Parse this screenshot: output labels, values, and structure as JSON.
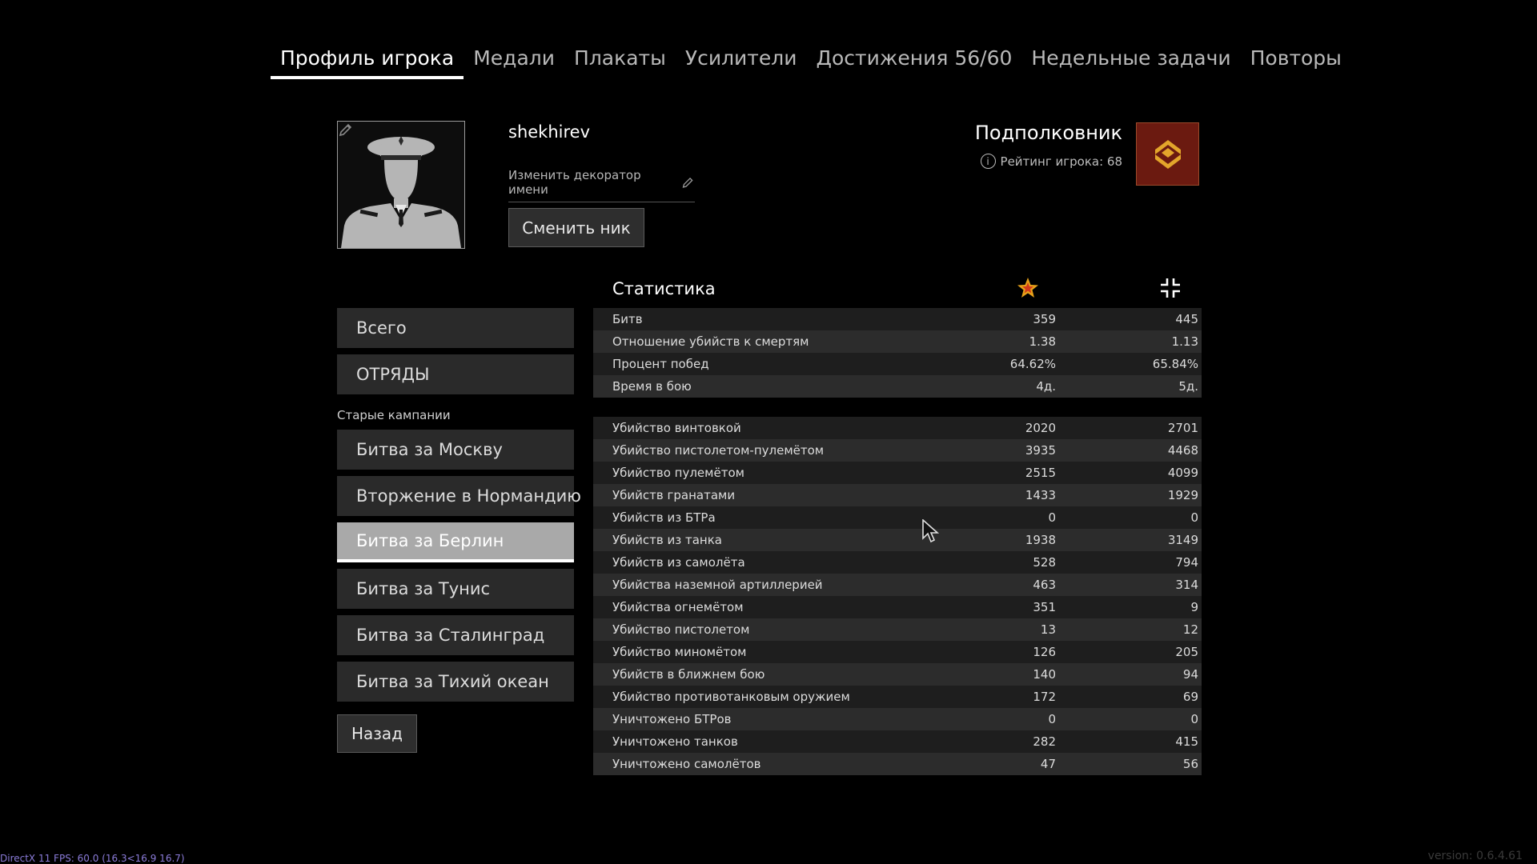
{
  "tabs": [
    {
      "label": "Профиль игрока",
      "active": true
    },
    {
      "label": "Медали"
    },
    {
      "label": "Плакаты"
    },
    {
      "label": "Усилители"
    },
    {
      "label": "Достижения 56/60"
    },
    {
      "label": "Недельные задачи"
    },
    {
      "label": "Повторы"
    }
  ],
  "profile": {
    "username": "shekhirev",
    "decorator_label": "Изменить декоратор имени",
    "change_nick_label": "Сменить ник",
    "rank_title": "Подполковник",
    "rating_label": "Рейтинг игрока: 68"
  },
  "menu": {
    "items_top": [
      "Всего",
      "ОТРЯДЫ"
    ],
    "section_label": "Старые кампании",
    "campaigns": [
      "Битва за Москву",
      "Вторжение в Нормандию",
      "Битва за Берлин",
      "Битва за Тунис",
      "Битва за Сталинград",
      "Битва за Тихий океан"
    ],
    "active_campaign": "Битва за Берлин",
    "back_label": "Назад"
  },
  "stats": {
    "title": "Статистика",
    "colors": {
      "star": "#e8a21a",
      "star_center": "#d43a1a"
    },
    "group1": [
      {
        "label": "Битв",
        "v1": "359",
        "v2": "445"
      },
      {
        "label": "Отношение убийств к смертям",
        "v1": "1.38",
        "v2": "1.13"
      },
      {
        "label": "Процент побед",
        "v1": "64.62%",
        "v2": "65.84%"
      },
      {
        "label": "Время в бою",
        "v1": "4д.",
        "v2": "5д."
      }
    ],
    "group2": [
      {
        "label": "Убийство винтовкой",
        "v1": "2020",
        "v2": "2701"
      },
      {
        "label": "Убийство пистолетом-пулемётом",
        "v1": "3935",
        "v2": "4468"
      },
      {
        "label": "Убийство пулемётом",
        "v1": "2515",
        "v2": "4099"
      },
      {
        "label": "Убийств гранатами",
        "v1": "1433",
        "v2": "1929"
      },
      {
        "label": "Убийств из БТРа",
        "v1": "0",
        "v2": "0"
      },
      {
        "label": "Убийств из танка",
        "v1": "1938",
        "v2": "3149"
      },
      {
        "label": "Убийств из самолёта",
        "v1": "528",
        "v2": "794"
      },
      {
        "label": "Убийства наземной артиллерией",
        "v1": "463",
        "v2": "314"
      },
      {
        "label": "Убийства огнемётом",
        "v1": "351",
        "v2": "9"
      },
      {
        "label": "Убийство пистолетом",
        "v1": "13",
        "v2": "12"
      },
      {
        "label": "Убийство миномётом",
        "v1": "126",
        "v2": "205"
      },
      {
        "label": "Убийств в ближнем бою",
        "v1": "140",
        "v2": "94"
      },
      {
        "label": "Убийство противотанковым оружием",
        "v1": "172",
        "v2": "69"
      },
      {
        "label": "Уничтожено БТРов",
        "v1": "0",
        "v2": "0"
      },
      {
        "label": "Уничтожено танков",
        "v1": "282",
        "v2": "415"
      },
      {
        "label": "Уничтожено самолётов",
        "v1": "47",
        "v2": "56"
      }
    ]
  },
  "footer": {
    "fps": "DirectX 11 FPS: 60.0 (16.3<16.9 16.7)",
    "version": "version: 0.6.4.61"
  }
}
